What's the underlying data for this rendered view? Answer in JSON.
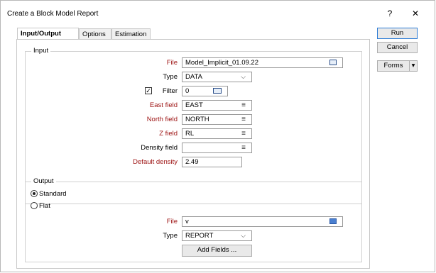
{
  "window": {
    "title": "Create a Block Model Report",
    "help": "?",
    "close": "✕"
  },
  "tabs": [
    {
      "label": "Input/Output"
    },
    {
      "label": "Options"
    },
    {
      "label": "Estimation"
    }
  ],
  "input": {
    "legend": "Input",
    "file": {
      "label": "File",
      "value": "Model_Implicit_01.09.22"
    },
    "type": {
      "label": "Type",
      "value": "DATA"
    },
    "filter": {
      "label": "Filter",
      "checked": true,
      "value": "0"
    },
    "east": {
      "label": "East field",
      "value": "EAST"
    },
    "north": {
      "label": "North field",
      "value": "NORTH"
    },
    "z": {
      "label": "Z field",
      "value": "RL"
    },
    "density": {
      "label": "Density field",
      "value": ""
    },
    "default_density": {
      "label": "Default density",
      "value": "2.49"
    }
  },
  "output": {
    "legend": "Output",
    "standard": {
      "label": "Standard",
      "selected": true
    },
    "flat": {
      "label": "Flat",
      "selected": false
    },
    "file": {
      "label": "File",
      "value": "v"
    },
    "type": {
      "label": "Type",
      "value": "REPORT"
    },
    "add_fields": "Add Fields ..."
  },
  "side": {
    "run": "Run",
    "cancel": "Cancel",
    "forms": "Forms",
    "forms_arrow": "▾"
  },
  "glyphs": {
    "menu": "≡",
    "chevron": "⌵",
    "check": "✓"
  },
  "colors": {
    "required_label": "#9c1010",
    "accent_border": "#2b7bd6"
  }
}
